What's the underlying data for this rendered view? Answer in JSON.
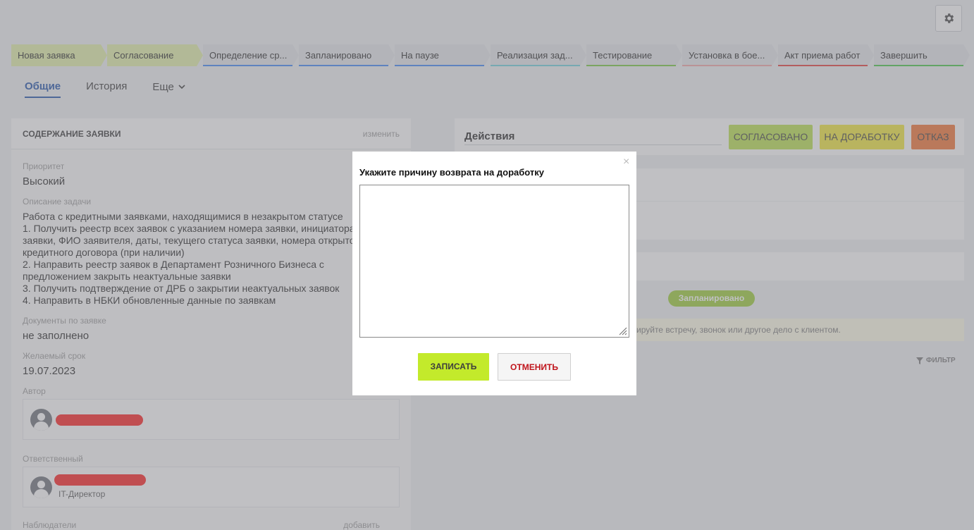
{
  "stages": [
    {
      "label": "Новая заявка",
      "state": "active",
      "bar": ""
    },
    {
      "label": "Согласование",
      "state": "active",
      "bar": ""
    },
    {
      "label": "Определение ср...",
      "state": "inactive",
      "bar": "#3b82f6"
    },
    {
      "label": "Запланировано",
      "state": "inactive",
      "bar": "#3b82f6"
    },
    {
      "label": "На паузе",
      "state": "inactive",
      "bar": "#3b82f6"
    },
    {
      "label": "Реализация зад...",
      "state": "inactive",
      "bar": "#6ad1dd"
    },
    {
      "label": "Тестирование",
      "state": "inactive",
      "bar": "#74c63a"
    },
    {
      "label": "Установка в бое...",
      "state": "inactive",
      "bar": "#f3a2a2"
    },
    {
      "label": "Акт приема работ",
      "state": "inactive",
      "bar": "#e53935"
    },
    {
      "label": "Завершить",
      "state": "inactive",
      "bar": "#43c443"
    }
  ],
  "tabs": {
    "general": "Общие",
    "history": "История",
    "more": "Еще"
  },
  "left": {
    "title": "СОДЕРЖАНИЕ ЗАЯВКИ",
    "edit": "изменить",
    "priority_label": "Приоритет",
    "priority_value": "Высокий",
    "description_label": "Описание задачи",
    "description_lines": [
      "Работа с кредитными заявками, находящимися в незакрытом статусе",
      "1. Получить реестр всех заявок с указанием номера заявки, инициатора",
      "заявки, ФИО заявителя, даты, текущего статуса заявки, номера открытого",
      "кредитного договора (при наличии)",
      "2. Направить реестр заявок в Департамент Розничного Бизнеса с",
      "предложением закрыть неактуальные заявки",
      "3. Получить подтверждение от ДРБ о закрытии неактуальных заявок",
      "4. Направить в НБКИ обновленные данные по заявкам"
    ],
    "docs_label": "Документы по заявке",
    "docs_value": "не заполнено",
    "deadline_label": "Желаемый срок",
    "deadline_value": "19.07.2023",
    "author_label": "Автор",
    "responsible_label": "Ответственный",
    "responsible_role": "IT-Директор",
    "observers_label": "Наблюдатели",
    "observers_add": "добавить"
  },
  "right": {
    "actions_title": "Действия",
    "btn_approved": "СОГЛАСОВАНО",
    "btn_rework": "НА ДОРАБОТКУ",
    "btn_refuse": "ОТКАЗ",
    "status_pill": "Запланировано",
    "hint": "ируйте встречу, звонок или другое дело с клиентом.",
    "filter": "ФИЛЬТР"
  },
  "modal": {
    "close": "×",
    "title": "Укажите причину возврата на доработку",
    "textarea_value": "",
    "save": "ЗАПИСАТЬ",
    "cancel": "ОТМЕНИТЬ"
  }
}
